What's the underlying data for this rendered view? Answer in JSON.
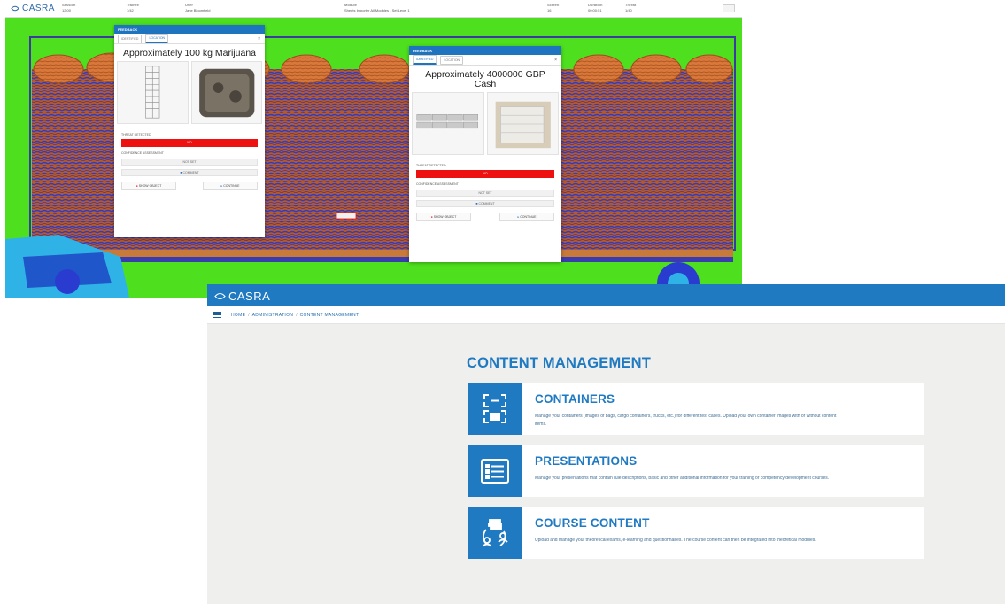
{
  "xray_window": {
    "logo": "CASRA",
    "header_fields": [
      {
        "label": "Session",
        "value": "12:00"
      },
      {
        "label": "Trainee",
        "value": "1/42"
      },
      {
        "label": "User",
        "value": "Jane Bloomfield"
      },
      {
        "label": "Module",
        "value": "Sheets Importer All Modules - Set Level 1"
      },
      {
        "label": "Screen",
        "value": "16"
      },
      {
        "label": "Duration",
        "value": "00:00:51"
      },
      {
        "label": "Threat",
        "value": "1/40"
      }
    ],
    "panel_left": {
      "header": "FEEDBACK",
      "tab1": "IDENTIFIED",
      "tab2": "LOCATION",
      "title": "Approximately 100 kg Marijuana",
      "threat_label": "THREAT DETECTED",
      "threat_value": "NO",
      "confidence_label": "CONFIDENCE ASSESSMENT",
      "confidence_value": "NOT SET",
      "comment_button": "COMMENT",
      "action_left": "SHOW OBJECT",
      "action_right": "CONTINUE"
    },
    "panel_right": {
      "header": "FEEDBACK",
      "tab1": "IDENTIFIED",
      "tab2": "LOCATION",
      "title": "Approximately 4000000 GBP Cash",
      "threat_label": "THREAT DETECTED",
      "threat_value": "NO",
      "confidence_label": "CONFIDENCE ASSESSMENT",
      "confidence_value": "NOT SET",
      "comment_button": "COMMENT",
      "action_left": "SHOW OBJECT",
      "action_right": "CONTINUE"
    }
  },
  "cm_window": {
    "logo": "CASRA",
    "breadcrumb": [
      "HOME",
      "ADMINISTRATION",
      "CONTENT MANAGEMENT"
    ],
    "heading": "CONTENT MANAGEMENT",
    "cards": [
      {
        "icon": "containers-icon",
        "title": "CONTAINERS",
        "desc": "Manage your containers (images of bags, cargo containers, trucks, etc.) for different test cases. Upload your own container images with or without content items."
      },
      {
        "icon": "presentations-icon",
        "title": "PRESENTATIONS",
        "desc": "Manage your presentations that contain rule descriptions, basic and other additional information for your training or competency development courses."
      },
      {
        "icon": "course-content-icon",
        "title": "COURSE CONTENT",
        "desc": "Upload and manage your theoretical exams, e-learning and questionnaires. The course content can then be integrated into theoretical modules."
      }
    ]
  },
  "colors": {
    "brand_blue": "#1f7ac2",
    "xray_green": "#4ee01e",
    "threat_red": "#ee1111"
  }
}
